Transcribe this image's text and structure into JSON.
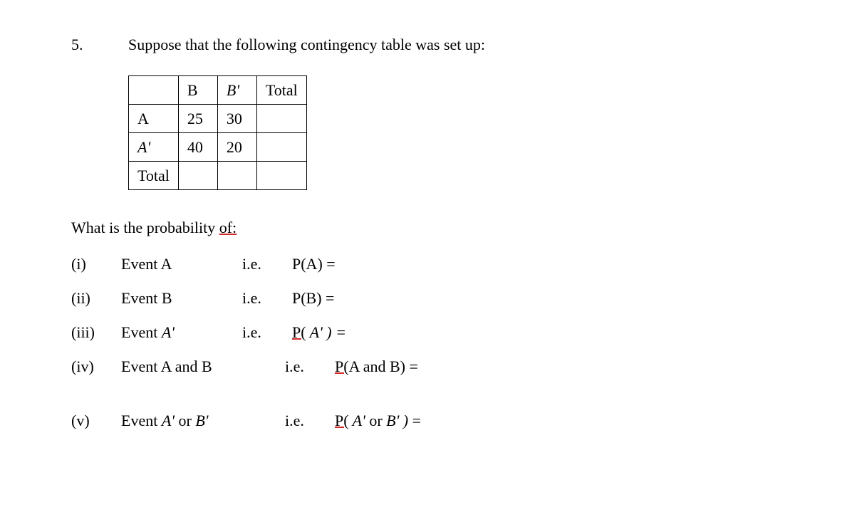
{
  "problem": {
    "number": "5.",
    "text": "Suppose that the following contingency table was set up:"
  },
  "table": {
    "headers": {
      "col1_blank": "",
      "B": "B",
      "Bprime": "B'",
      "Total": "Total"
    },
    "rows": [
      {
        "label": "A",
        "B": "25",
        "Bprime": "30",
        "Total": ""
      },
      {
        "label": "A'",
        "B": "40",
        "Bprime": "20",
        "Total": ""
      },
      {
        "label": "Total",
        "B": "",
        "Bprime": "",
        "Total": ""
      }
    ]
  },
  "intro": {
    "text_before": "What is the probability ",
    "of": "of:"
  },
  "questions": [
    {
      "num": "(i)",
      "event": "Event A",
      "ie": "i.e.",
      "prob_prefix": "",
      "prob": "P(A) ="
    },
    {
      "num": "(ii)",
      "event": "Event B",
      "ie": "i.e.",
      "prob_prefix": "",
      "prob": "P(B) ="
    },
    {
      "num": "(iii)",
      "event_prefix": "Event ",
      "event_italic": "A'",
      "ie": "i.e.",
      "prob_underline_part": "P(",
      "prob_rest": " A' ) ="
    },
    {
      "num": "(iv)",
      "event": "Event A and B",
      "ie": "i.e.",
      "prob_underline_part": "P(",
      "prob_rest": "A and B) ="
    },
    {
      "num": "(v)",
      "event_prefix": "Event ",
      "event_italic1": "A'",
      "event_mid": " or ",
      "event_italic2": "B'",
      "ie": "i.e.",
      "prob_underline_part": "P(",
      "prob_rest_italic1": " A'",
      "prob_rest_mid": " or ",
      "prob_rest_italic2": "B' )",
      "prob_eq": " ="
    }
  ]
}
